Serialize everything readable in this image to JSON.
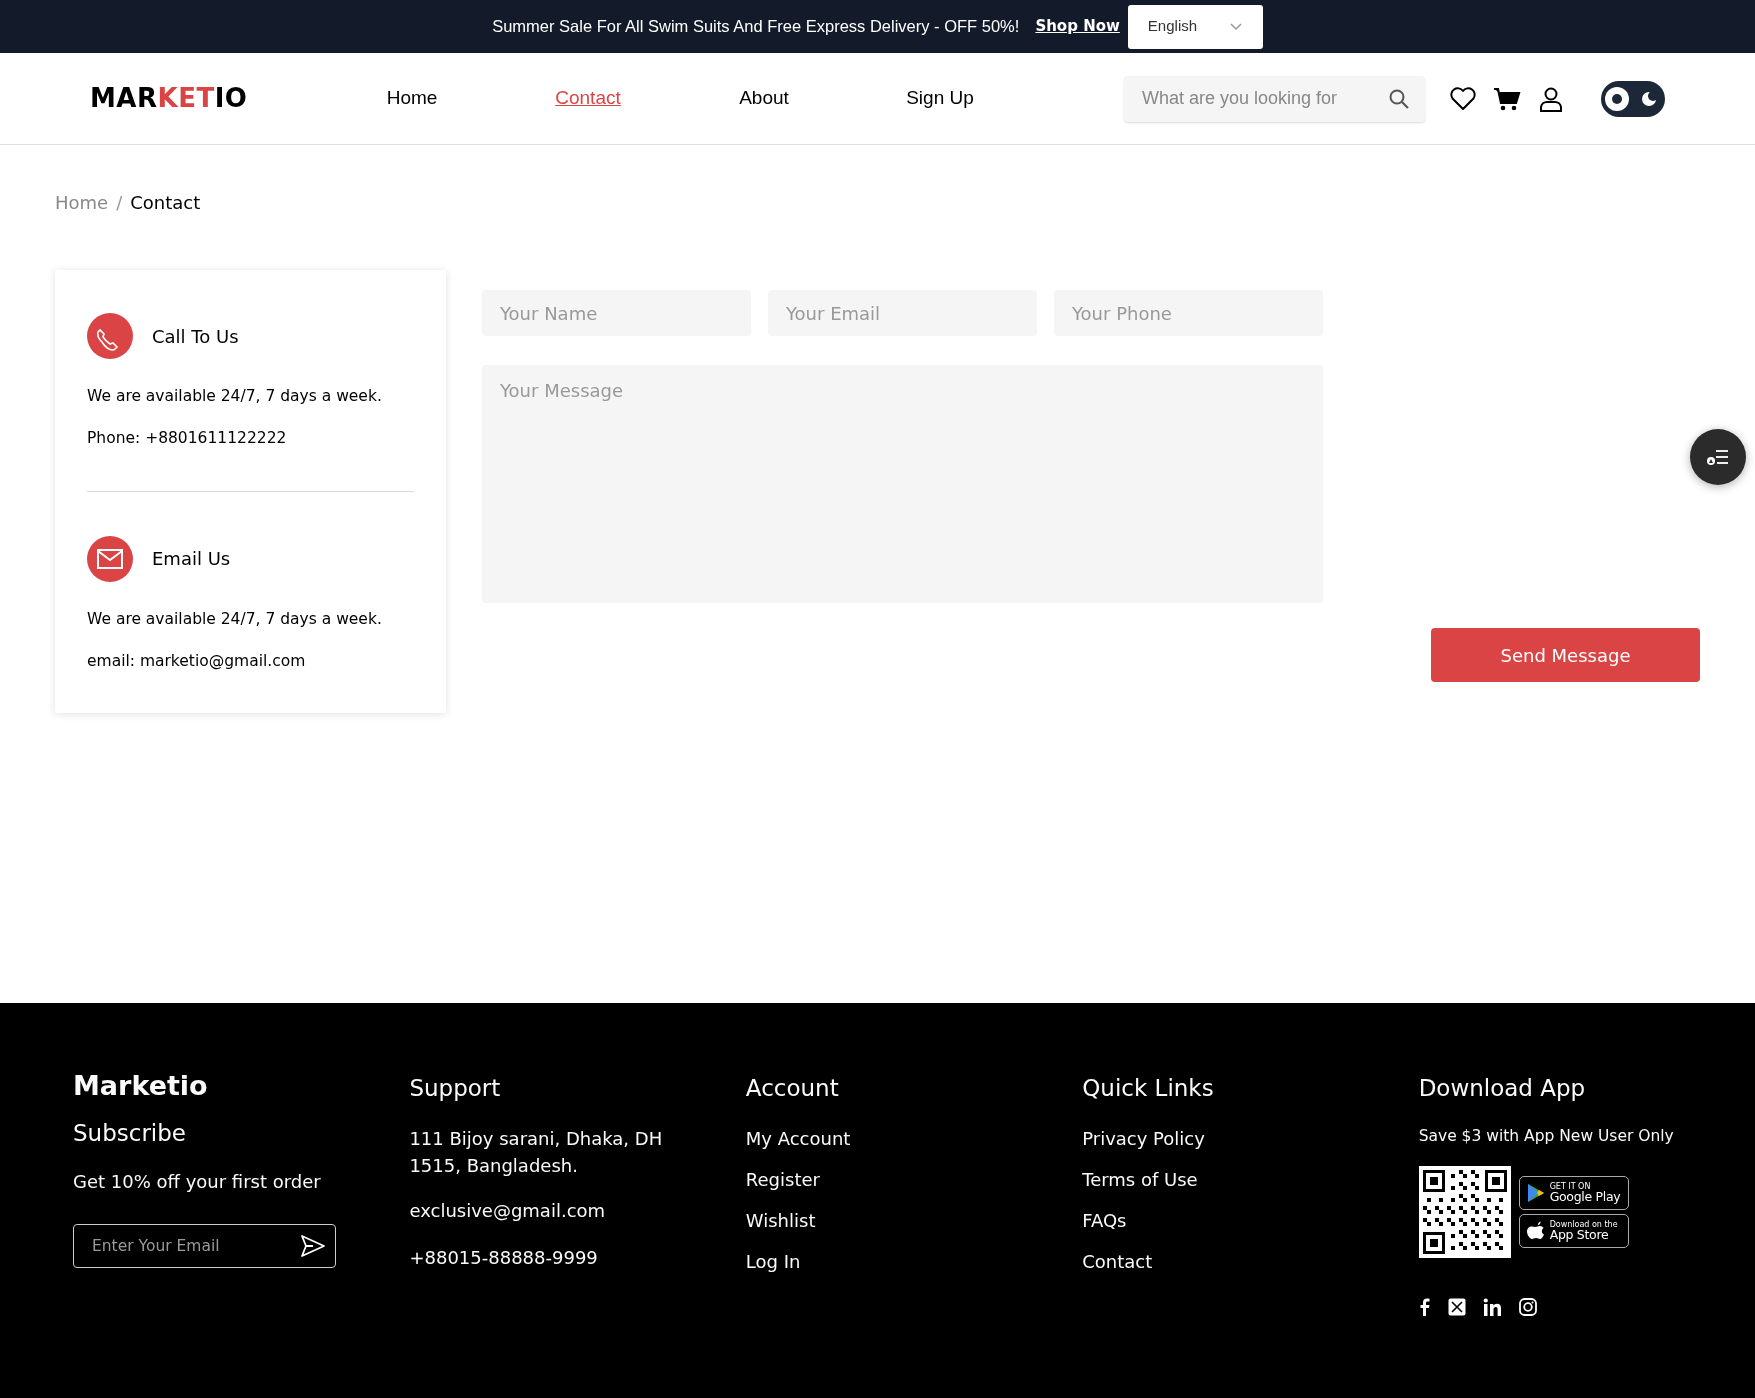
{
  "top_bar": {
    "message": "Summer Sale For All Swim Suits And Free Express Delivery - OFF 50%!",
    "link": "Shop Now",
    "language": "English"
  },
  "header": {
    "logo": [
      {
        "text": "MAR",
        "accent": false
      },
      {
        "text": "KET",
        "accent": true
      },
      {
        "text": "IO",
        "accent": false
      }
    ],
    "nav": [
      {
        "label": "Home",
        "selected": false
      },
      {
        "label": "Contact",
        "selected": true
      },
      {
        "label": "About",
        "selected": false
      },
      {
        "label": "Sign Up",
        "selected": false
      }
    ],
    "search": {
      "placeholder": "What are you looking for"
    },
    "theme_toggle": {
      "dark": false
    }
  },
  "breadcrumb": {
    "separator": "/",
    "items": [
      {
        "label": "Home",
        "current": false
      },
      {
        "label": "Contact",
        "current": true
      }
    ]
  },
  "contact_info": [
    {
      "kind": "phone",
      "title": "Call To Us",
      "lines": [
        "We are available 24/7, 7 days a week.",
        "Phone: +8801611122222"
      ]
    },
    {
      "kind": "email",
      "title": "Email Us",
      "lines": [
        "We are available 24/7, 7 days a week.",
        "email: marketio@gmail.com"
      ]
    }
  ],
  "form": {
    "fields": [
      {
        "placeholder": "Your Name"
      },
      {
        "placeholder": "Your Email"
      },
      {
        "placeholder": "Your Phone"
      }
    ],
    "message": {
      "placeholder": "Your Message"
    },
    "submit": "Send Message"
  },
  "footer": {
    "brand": "Marketio",
    "subscribe": {
      "title": "Subscribe",
      "text": "Get 10% off your first order",
      "placeholder": "Enter Your Email"
    },
    "support": {
      "title": "Support",
      "address": "111 Bijoy sarani, Dhaka, DH 1515, Bangladesh.",
      "email": "exclusive@gmail.com",
      "phone": "+88015-88888-9999"
    },
    "account": {
      "title": "Account",
      "links": [
        "My Account",
        "Register",
        "Wishlist",
        "Log In"
      ]
    },
    "quick_links": {
      "title": "Quick Links",
      "links": [
        "Privacy Policy",
        "Terms of Use",
        "FAQs",
        "Contact"
      ]
    },
    "download": {
      "title": "Download App",
      "note": "Save $3 with App New User Only",
      "badges": [
        {
          "kind": "google",
          "small": "GET IT ON",
          "big": "Google Play"
        },
        {
          "kind": "apple",
          "small": "Download on the",
          "big": "App Store"
        }
      ],
      "socials": [
        {
          "kind": "facebook"
        },
        {
          "kind": "x"
        },
        {
          "kind": "linkedin"
        },
        {
          "kind": "instagram"
        }
      ]
    }
  }
}
